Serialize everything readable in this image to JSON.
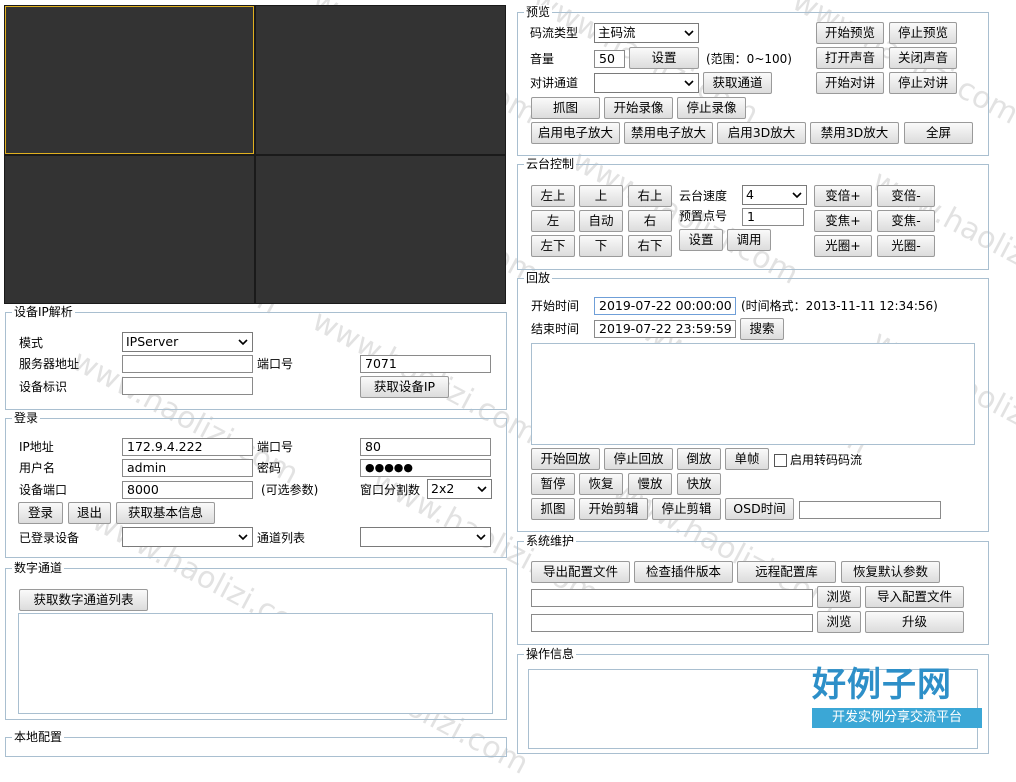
{
  "video": {
    "cells": 4
  },
  "ipparse": {
    "legend": "设备IP解析",
    "mode_label": "模式",
    "mode_value": "IPServer",
    "server_label": "服务器地址",
    "server_value": "",
    "port_label": "端口号",
    "port_value": "7071",
    "devid_label": "设备标识",
    "devid_value": "",
    "get_ip": "获取设备IP"
  },
  "login": {
    "legend": "登录",
    "ip_label": "IP地址",
    "ip_value": "172.9.4.222",
    "port_label": "端口号",
    "port_value": "80",
    "user_label": "用户名",
    "user_value": "admin",
    "pwd_label": "密码",
    "pwd_value": "●●●●●",
    "devport_label": "设备端口",
    "devport_value": "8000",
    "devport_hint": "(可选参数)",
    "split_label": "窗口分割数",
    "split_value": "2x2",
    "login_btn": "登录",
    "logout_btn": "退出",
    "info_btn": "获取基本信息",
    "logged_label": "已登录设备",
    "logged_value": "",
    "channel_label": "通道列表",
    "channel_value": ""
  },
  "digital": {
    "legend": "数字通道",
    "get_btn": "获取数字通道列表"
  },
  "local": {
    "legend": "本地配置"
  },
  "preview": {
    "legend": "预览",
    "stream_label": "码流类型",
    "stream_value": "主码流",
    "start": "开始预览",
    "stop": "停止预览",
    "volume_label": "音量",
    "volume_value": "50",
    "set": "设置",
    "volume_range": "(范围：0~100)",
    "open_sound": "打开声音",
    "close_sound": "关闭声音",
    "talk_label": "对讲通道",
    "talk_value": "",
    "get_channel": "获取通道",
    "start_talk": "开始对讲",
    "stop_talk": "停止对讲",
    "capture": "抓图",
    "start_record": "开始录像",
    "stop_record": "停止录像",
    "ezoom_on": "启用电子放大",
    "ezoom_off": "禁用电子放大",
    "zoom3d_on": "启用3D放大",
    "zoom3d_off": "禁用3D放大",
    "fullscreen": "全屏"
  },
  "ptz": {
    "legend": "云台控制",
    "upleft": "左上",
    "up": "上",
    "upright": "右上",
    "left": "左",
    "auto": "自动",
    "right": "右",
    "downleft": "左下",
    "down": "下",
    "downright": "右下",
    "speed_label": "云台速度",
    "speed_value": "4",
    "preset_label": "预置点号",
    "preset_value": "1",
    "set": "设置",
    "call": "调用",
    "zoom_in": "变倍+",
    "zoom_out": "变倍-",
    "focus_in": "变焦+",
    "focus_out": "变焦-",
    "iris_in": "光圈+",
    "iris_out": "光圈-"
  },
  "playback": {
    "legend": "回放",
    "start_label": "开始时间",
    "start_value": "2019-07-22 00:00:00",
    "format_hint": "(时间格式：2013-11-11 12:34:56)",
    "end_label": "结束时间",
    "end_value": "2019-07-22 23:59:59",
    "search": "搜索",
    "start_pb": "开始回放",
    "stop_pb": "停止回放",
    "reverse": "倒放",
    "single_frame": "单帧",
    "transcode_label": "启用转码码流",
    "pause": "暂停",
    "resume": "恢复",
    "slow": "慢放",
    "fast": "快放",
    "capture": "抓图",
    "start_clip": "开始剪辑",
    "stop_clip": "停止剪辑",
    "osd_time": "OSD时间",
    "osd_value": ""
  },
  "maintain": {
    "legend": "系统维护",
    "export_cfg": "导出配置文件",
    "check_plugin": "检查插件版本",
    "remote_cfg": "远程配置库",
    "restore_default": "恢复默认参数",
    "browse1": "浏览",
    "import_cfg": "导入配置文件",
    "browse2": "浏览",
    "upgrade": "升级"
  },
  "oplog": {
    "legend": "操作信息"
  },
  "watermark": {
    "text": "www.haolizi.com",
    "logo_title": "好例子网",
    "logo_sub": "开发实例分享交流平台"
  }
}
